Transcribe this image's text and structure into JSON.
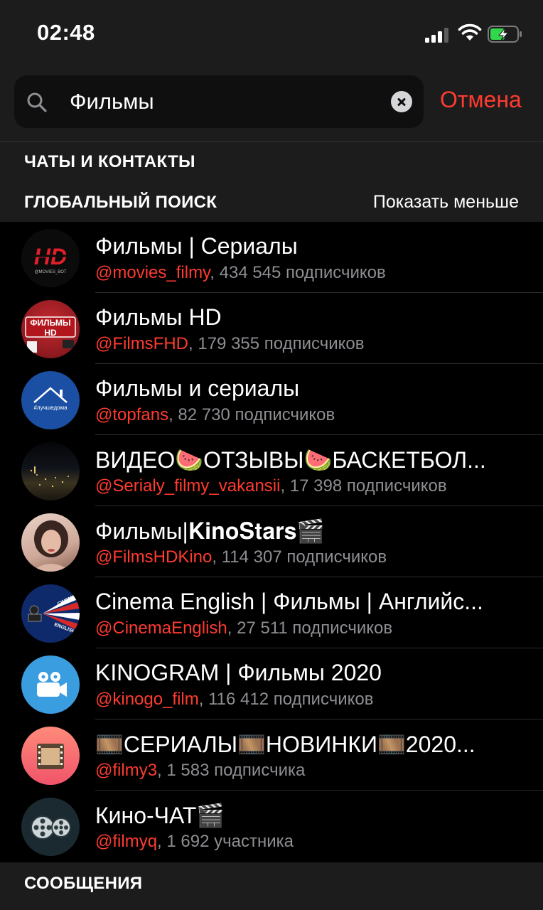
{
  "status_bar": {
    "time": "02:48"
  },
  "search": {
    "value": "Фильмы",
    "cancel_label": "Отмена"
  },
  "sections": {
    "chats_contacts": "ЧАТЫ И КОНТАКТЫ",
    "global_search": "ГЛОБАЛЬНЫЙ ПОИСК",
    "show_less": "Показать меньше",
    "messages": "СООБЩЕНИЯ"
  },
  "results": [
    {
      "title": "Фильмы | Сериалы",
      "username": "@movies_filmy",
      "meta": ", 434 545 подписчиков",
      "avatar_icon": "hd-logo-icon",
      "avatar_text": "@MOVIES_BOT"
    },
    {
      "title": "Фильмы HD",
      "username": "@FilmsFHD",
      "meta": ", 179 355 подписчиков",
      "avatar_icon": "films-hd-badge-icon",
      "avatar_text": "ФИЛЬМЫ HD"
    },
    {
      "title": "Фильмы и сериалы",
      "username": "@topfans",
      "meta": ", 82 730 подписчиков",
      "avatar_icon": "house-icon",
      "avatar_text": "#лучшедома"
    },
    {
      "title": "ВИДЕО🍉ОТЗЫВЫ🍉БАСКЕТБОЛ...",
      "username": "@Serialy_filmy_vakansii",
      "meta": ", 17 398 подписчиков",
      "avatar_icon": "night-city-photo"
    },
    {
      "title": "Фильмы|𝐊𝐢𝐧𝐨𝐒𝐭𝐚𝐫𝐬🎬",
      "username": "@FilmsHDKino",
      "meta": ", 114 307 подписчиков",
      "avatar_icon": "portrait-photo"
    },
    {
      "title": "Cinema English | Фильмы | Английс...",
      "username": "@CinemaEnglish",
      "meta": ", 27 511 подписчиков",
      "avatar_icon": "cinema-camera-icon",
      "avatar_text": "CINEMA ENGLISH"
    },
    {
      "title": "KINOGRAM | Фильмы 2020",
      "username": "@kinogo_film",
      "meta": ", 116 412 подписчиков",
      "avatar_icon": "video-camera-icon"
    },
    {
      "title": "🎞️СЕРИАЛЫ🎞️НОВИНКИ🎞️2020...",
      "username": "@filmy3",
      "meta": ", 1 583 подписчика",
      "avatar_icon": "film-strip-icon"
    },
    {
      "title": "Кино-ЧАТ🎬",
      "username": "@filmyq",
      "meta": ", 1 692 участника",
      "avatar_icon": "film-reels-icon"
    }
  ],
  "colors": {
    "accent_red": "#ff3b30",
    "background": "#000000",
    "header_bg": "#1c1c1d",
    "meta_gray": "#8e8e93"
  }
}
